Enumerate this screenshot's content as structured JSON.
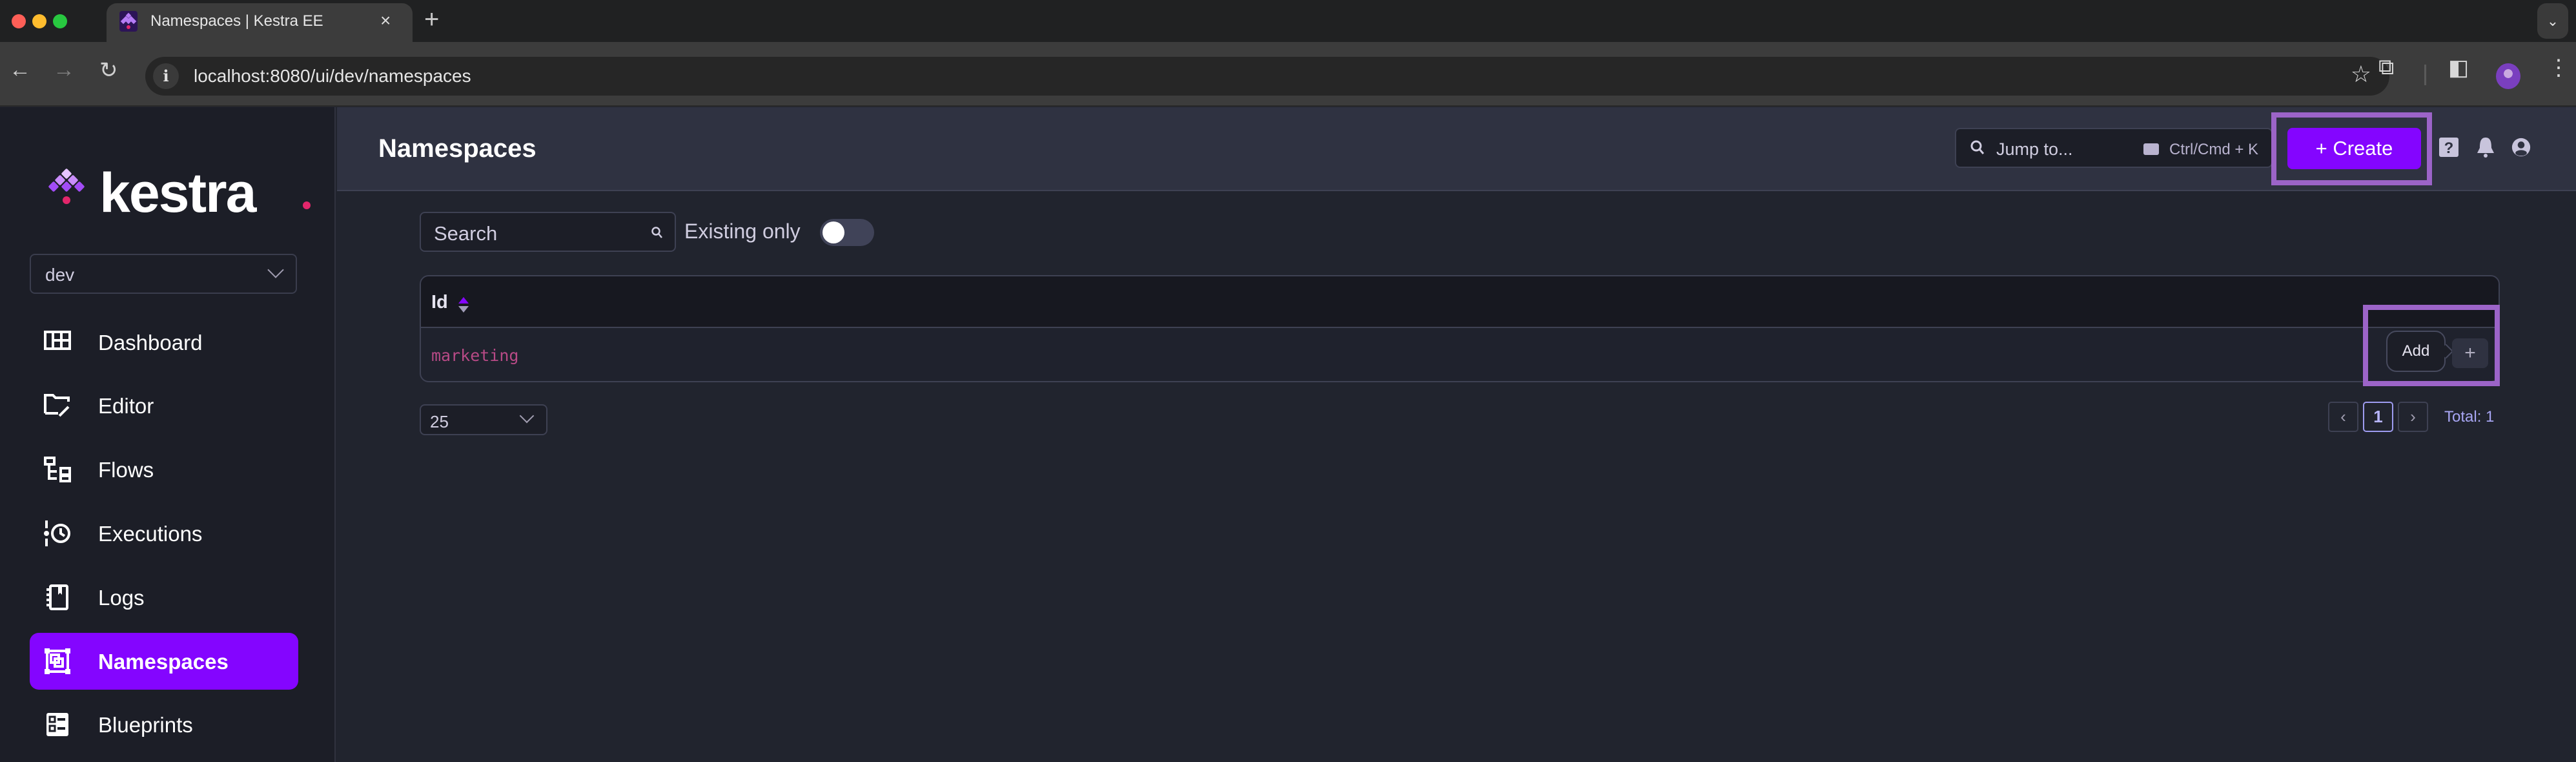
{
  "browser": {
    "tab_title": "Namespaces | Kestra EE",
    "tab_close": "×",
    "new_tab": "+",
    "tab_menu": "⌄",
    "url": "localhost:8080/ui/dev/namespaces",
    "back": "←",
    "forward": "→",
    "reload": "↻",
    "info": "i",
    "bookmark": "☆",
    "extensions": "⧉",
    "side_panel": "◧",
    "menu": "⋮"
  },
  "sidebar": {
    "logo_text": "kestra",
    "environment": {
      "selected": "dev"
    },
    "items": [
      {
        "label": "Dashboard",
        "icon": "dashboard-icon",
        "active": false
      },
      {
        "label": "Editor",
        "icon": "editor-icon",
        "active": false
      },
      {
        "label": "Flows",
        "icon": "flows-icon",
        "active": false
      },
      {
        "label": "Executions",
        "icon": "executions-icon",
        "active": false
      },
      {
        "label": "Logs",
        "icon": "logs-icon",
        "active": false
      },
      {
        "label": "Namespaces",
        "icon": "namespaces-icon",
        "active": true
      },
      {
        "label": "Blueprints",
        "icon": "blueprints-icon",
        "active": false
      }
    ]
  },
  "header": {
    "title": "Namespaces",
    "jump_to": {
      "placeholder": "Jump to...",
      "shortcut": "Ctrl/Cmd + K"
    },
    "create_label": "+  Create",
    "icons": [
      "help-icon",
      "bell-icon",
      "user-icon"
    ]
  },
  "filters": {
    "search_placeholder": "Search",
    "existing_only_label": "Existing only",
    "existing_only": false
  },
  "table": {
    "columns": [
      {
        "label": "Id",
        "sortable": true
      }
    ],
    "rows": [
      {
        "id": "marketing"
      }
    ],
    "row_action": {
      "tooltip": "Add",
      "icon": "+"
    }
  },
  "pagination": {
    "per_page": "25",
    "prev": "‹",
    "current_page": "1",
    "next": "›",
    "total_label": "Total: 1"
  },
  "colors": {
    "accent": "#8405ff",
    "highlight": "#9c64c8",
    "id_text": "#b84a86",
    "total_text": "#a8a6f4"
  }
}
